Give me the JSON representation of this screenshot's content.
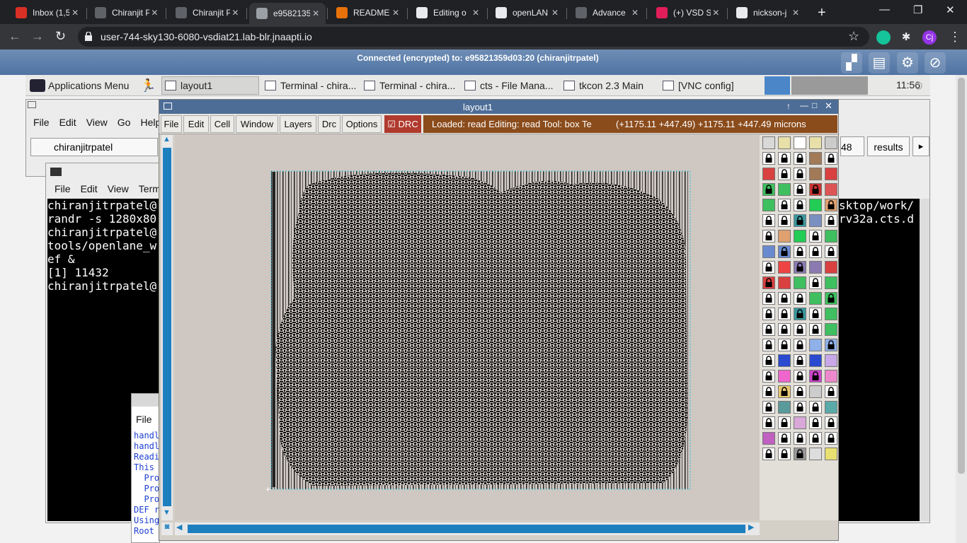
{
  "browser": {
    "tabs": [
      {
        "label": "Inbox (1,5",
        "color": "#d93025",
        "active": false
      },
      {
        "label": "Chiranjit P",
        "color": "#5f6368",
        "active": false
      },
      {
        "label": "Chiranjit P",
        "color": "#5f6368",
        "active": false
      },
      {
        "label": "e9582135",
        "color": "#9aa0a6",
        "active": true
      },
      {
        "label": "README",
        "color": "#e8710a",
        "active": false
      },
      {
        "label": "Editing o",
        "color": "#e8eaed",
        "active": false
      },
      {
        "label": "openLAN",
        "color": "#e8eaed",
        "active": false
      },
      {
        "label": "Advance",
        "color": "#5f6368",
        "active": false
      },
      {
        "label": "(+) VSD S",
        "color": "#e01e5a",
        "active": false
      },
      {
        "label": "nickson-j",
        "color": "#e8eaed",
        "active": false
      }
    ],
    "url": "user-744-sky130-6080-vsdiat21.lab-blr.jnaapti.io",
    "profile_initials": "Cj"
  },
  "vnc": {
    "status": "Connected (encrypted) to: e95821359d03:20 (chiranjitrpatel)"
  },
  "panel": {
    "apps_menu": "Applications Menu",
    "tasks": [
      {
        "label": "layout1",
        "sunk": true
      },
      {
        "label": "Terminal - chira...",
        "sunk": false
      },
      {
        "label": "Terminal - chira...",
        "sunk": false
      },
      {
        "label": "cts - File Mana...",
        "sunk": false
      },
      {
        "label": "tkcon 2.3 Main",
        "sunk": false
      },
      {
        "label": "[VNC config]",
        "sunk": false
      }
    ],
    "clock": "11:56"
  },
  "file_manager": {
    "menu": [
      "File",
      "Edit",
      "View",
      "Go",
      "Help"
    ],
    "location": "chiranjitrpatel"
  },
  "terminal1": {
    "menu": [
      "File",
      "Edit",
      "View",
      "Term"
    ],
    "lines": "chiranjitrpatel@\nrandr -s 1280x80\nchiranjitrpatel@\ntools/openlane_w\nef &\n[1] 11432\nchiranjitrpatel@"
  },
  "right_terminal": {
    "lines": "sktop/work/\nrv32a.cts.d",
    "results_label": "results",
    "num_label": "48"
  },
  "tkcon": {
    "menu": [
      "File"
    ],
    "lines": [
      "handl",
      "handl",
      "Readi",
      "This",
      "  Pro",
      "  Pro",
      "  Pro",
      "DEF r",
      "Using",
      "Root"
    ]
  },
  "layout1": {
    "title": "layout1",
    "menu": [
      "File",
      "Edit",
      "Cell",
      "Window",
      "Layers",
      "Drc",
      "Options"
    ],
    "drc_label": "DRC",
    "status": "Loaded: read Editing: read Tool: box  Te",
    "coords": "(+1175.11 +447.49) +1175.11 +447.49 microns"
  }
}
